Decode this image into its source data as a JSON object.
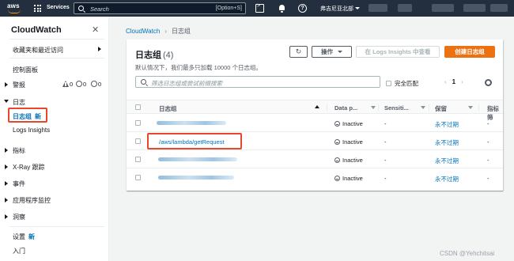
{
  "topbar": {
    "logo": "aws",
    "services": "Services",
    "search_placeholder": "Search",
    "search_shortcut": "[Option+S]",
    "region": "弗吉尼亚北部",
    "icons": [
      "apps-grid-icon",
      "terminal-icon",
      "bell-icon",
      "help-icon",
      "caret-down-icon"
    ]
  },
  "sidebar": {
    "title": "CloudWatch",
    "favorites": "收藏夹和最近访问",
    "dashboards": "控制面板",
    "alarms": "警报",
    "alarm_counts": [
      "0",
      "0",
      "0"
    ],
    "logs": "日志",
    "log_groups": "日志组",
    "new_badge": "新",
    "logs_insights": "Logs Insights",
    "metrics": "指标",
    "xray": "X-Ray 跟踪",
    "events": "事件",
    "app_monitoring": "应用程序监控",
    "insights": "洞察",
    "settings": "设置",
    "getting_started": "入门"
  },
  "breadcrumb": {
    "root": "CloudWatch",
    "current": "日志组"
  },
  "panel": {
    "title": "日志组",
    "count": "(4)",
    "description": "默认情况下，我们最多只加载 10000 个日志组。",
    "actions_label": "操作",
    "insights_label": "在 Logs Insights 中查看",
    "create_label": "创建日志组",
    "filter_placeholder": "筛选日志组或尝试前缀搜索",
    "exact_match": "完全匹配",
    "page": "1"
  },
  "table": {
    "columns": [
      "日志组",
      "Data p...",
      "Sensiti...",
      "保留",
      "指标筛"
    ],
    "rows": [
      {
        "name": "",
        "data_protection": "Inactive",
        "sensitive": "-",
        "retention": "永不过期",
        "metric": "-"
      },
      {
        "name": "/aws/lambda/getRequest",
        "data_protection": "Inactive",
        "sensitive": "-",
        "retention": "永不过期",
        "metric": "-"
      },
      {
        "name": "",
        "data_protection": "Inactive",
        "sensitive": "-",
        "retention": "永不过期",
        "metric": "-"
      },
      {
        "name": "",
        "data_protection": "Inactive",
        "sensitive": "-",
        "retention": "永不过期",
        "metric": "-"
      }
    ]
  },
  "watermark": "CSDN @Yehchitsai",
  "colors": {
    "topbar": "#232f3e",
    "accent": "#ec7211",
    "link": "#0073bb",
    "highlight": "#e8462d"
  }
}
